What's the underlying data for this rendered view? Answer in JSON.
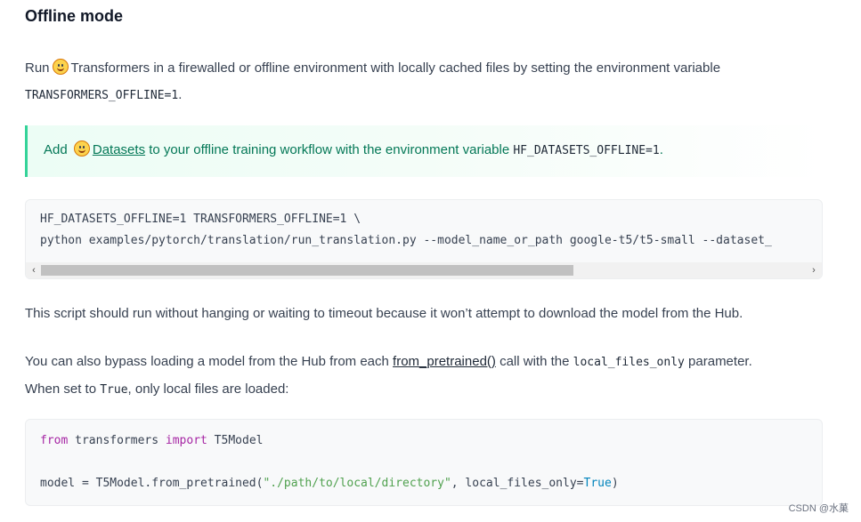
{
  "heading": "Offline mode",
  "para1": {
    "pre": "Run",
    "emoji": "hugging-face-emoji",
    "post": "Transformers in a firewalled or offline environment with locally cached files by setting the environment variable",
    "code": "TRANSFORMERS_OFFLINE=1",
    "end": "."
  },
  "tip": {
    "pre": "Add",
    "emoji": "hugging-face-emoji",
    "link": "Datasets",
    "post": " to your offline training workflow with the environment variable ",
    "code": "HF_DATASETS_OFFLINE=1",
    "end": "."
  },
  "codeblock1": {
    "line1": "HF_DATASETS_OFFLINE=1 TRANSFORMERS_OFFLINE=1 \\",
    "line2": "python examples/pytorch/translation/run_translation.py --model_name_or_path google-t5/t5-small --dataset_",
    "scroll_left": "‹",
    "scroll_right": "›"
  },
  "para2": "This script should run without hanging or waiting to timeout because it won’t attempt to download the model from the Hub.",
  "para3": {
    "pre": "You can also bypass loading a model from the Hub from each ",
    "link": "from_pretrained()",
    "mid": " call with the ",
    "code1": "local_files_only",
    "mid2": " parameter.",
    "line2_pre": "When set to ",
    "code2": "True",
    "line2_post": ", only local files are loaded:"
  },
  "codeblock2": {
    "from": "from",
    "module": " transformers ",
    "import": "import",
    "name": " T5Model",
    "assign": "model = T5Model.from_pretrained(",
    "path": "\"./path/to/local/directory\"",
    "arg": ", local_files_only=",
    "true": "True",
    "close": ")"
  },
  "watermark": "CSDN @水菓"
}
